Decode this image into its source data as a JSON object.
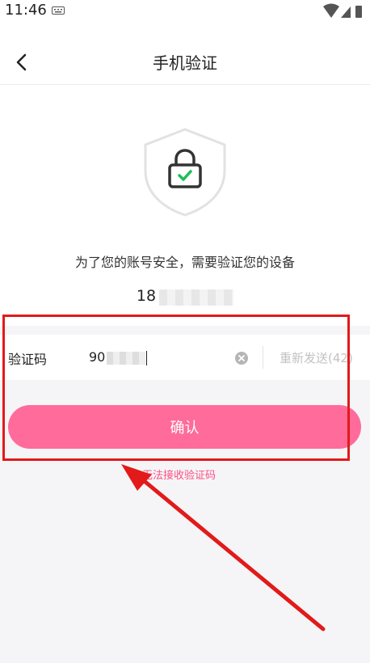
{
  "status_bar": {
    "time": "11:46",
    "keyboard_icon": "keyboard-icon",
    "wifi_icon": "wifi-icon",
    "signal_icon": "signal-icon",
    "battery_icon": "battery-icon"
  },
  "header": {
    "title": "手机验证",
    "back_icon": "chevron-left-icon"
  },
  "security": {
    "icon": "shield-lock-icon",
    "notice": "为了您的账号安全，需要验证您的设备",
    "phone_prefix": "18"
  },
  "code_row": {
    "label": "验证码",
    "value_prefix": "90",
    "clear_icon": "clear-circle-icon",
    "resend": "重新发送(42)"
  },
  "actions": {
    "confirm": "确认",
    "cant_receive": "无法接收验证码"
  },
  "colors": {
    "accent": "#ff6b9a",
    "link": "#ff4f85",
    "annotation": "#e21a1a"
  }
}
